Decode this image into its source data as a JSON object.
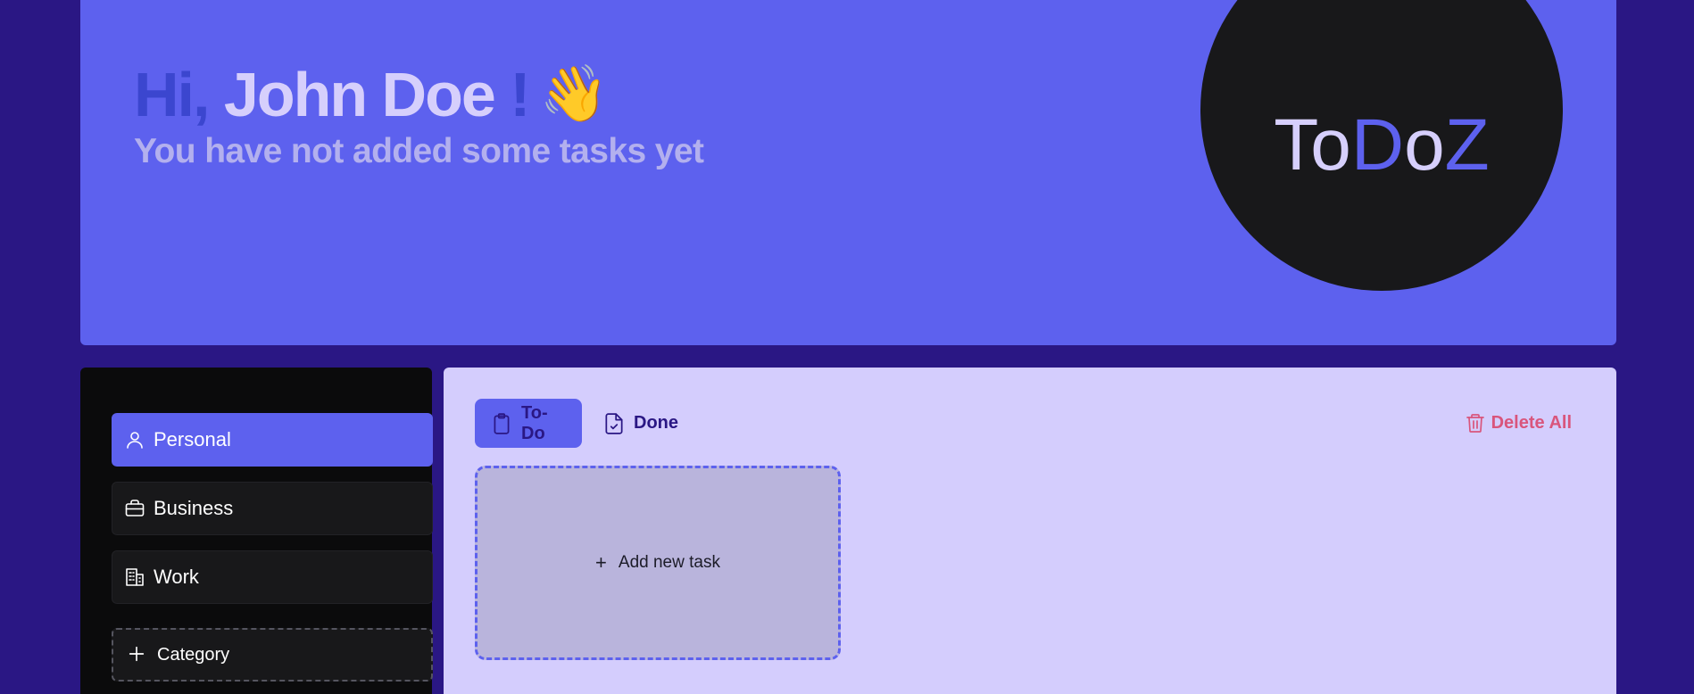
{
  "header": {
    "greeting_hi": "Hi,",
    "user_name": "John Doe",
    "greeting_bang": "!",
    "wave_emoji": "👋",
    "subtitle": "You have not added some tasks yet"
  },
  "logo": {
    "part1": "To",
    "part2": "D",
    "part3": "o",
    "part4": "Z"
  },
  "sidebar": {
    "categories": [
      {
        "label": "Personal",
        "icon": "person-icon",
        "active": true
      },
      {
        "label": "Business",
        "icon": "briefcase-icon",
        "active": false
      },
      {
        "label": "Work",
        "icon": "building-icon",
        "active": false
      }
    ],
    "add_category_label": "Category"
  },
  "main": {
    "tabs": [
      {
        "label": "To-Do",
        "icon": "clipboard-icon",
        "active": true
      },
      {
        "label": "Done",
        "icon": "file-check-icon",
        "active": false
      }
    ],
    "delete_all_label": "Delete All",
    "add_task_label": "Add new task"
  },
  "colors": {
    "background": "#2a1784",
    "accent": "#5d61ee",
    "panel_light": "#d4cdfd",
    "sidebar_bg": "#0b0b0c",
    "danger": "#d9557c"
  }
}
